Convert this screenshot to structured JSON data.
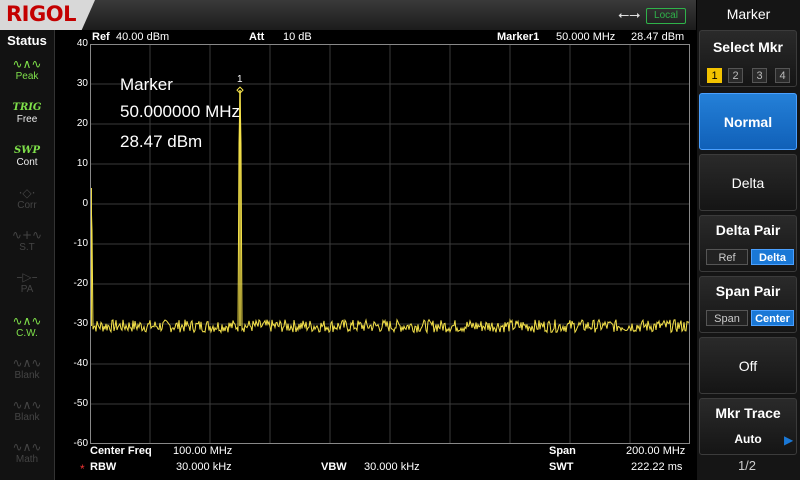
{
  "brand": "RIGOL",
  "remote_status": "Local",
  "status_panel": {
    "title": "Status",
    "items": [
      {
        "name": "peak",
        "label": "Peak",
        "active": true
      },
      {
        "name": "trig",
        "label": "TRIG",
        "value": "Free",
        "active": true
      },
      {
        "name": "swp",
        "label": "SWP",
        "value": "Cont",
        "active": true
      },
      {
        "name": "corr",
        "label": "Corr",
        "active": false
      },
      {
        "name": "st",
        "label": "S.T",
        "active": false
      },
      {
        "name": "pa",
        "label": "PA",
        "active": false
      },
      {
        "name": "cw",
        "label": "C.W.",
        "active": true
      },
      {
        "name": "blank1",
        "label": "Blank",
        "active": false
      },
      {
        "name": "blank2",
        "label": "Blank",
        "active": false
      },
      {
        "name": "math",
        "label": "Math",
        "active": false
      }
    ]
  },
  "header": {
    "ref_label": "Ref",
    "ref_value": "40.00 dBm",
    "att_label": "Att",
    "att_value": "10 dB",
    "marker_label": "Marker1",
    "marker_freq": "50.000 MHz",
    "marker_amp": "28.47 dBm"
  },
  "marker_readout": {
    "title": "Marker",
    "freq": "50.000000 MHz",
    "amp": "28.47 dBm",
    "tag": "1"
  },
  "footer": {
    "center_label": "Center Freq",
    "center_value": "100.00 MHz",
    "span_label": "Span",
    "span_value": "200.00 MHz",
    "rbw_label": "RBW",
    "rbw_value": "30.000 kHz",
    "vbw_label": "VBW",
    "vbw_value": "30.000 kHz",
    "swt_label": "SWT",
    "swt_value": "222.22 ms"
  },
  "softkeys": {
    "title": "Marker",
    "select_mkr": {
      "label": "Select Mkr",
      "options": [
        "1",
        "2",
        "3",
        "4"
      ],
      "selected": "1"
    },
    "normal": "Normal",
    "delta": "Delta",
    "delta_pair": {
      "label": "Delta Pair",
      "ref": "Ref",
      "delta": "Delta",
      "selected": "Delta"
    },
    "span_pair": {
      "label": "Span Pair",
      "span": "Span",
      "center": "Center",
      "selected": "Center"
    },
    "off": "Off",
    "mkr_trace": {
      "label": "Mkr Trace",
      "value": "Auto"
    },
    "page": "1/2"
  },
  "colors": {
    "trace": "#f5e24a",
    "grid": "#3a3a3a",
    "accent": "#1a78d6",
    "brand": "#c40000"
  },
  "chart_data": {
    "type": "line",
    "x_unit": "MHz",
    "y_unit": "dBm",
    "xlim": [
      0,
      200
    ],
    "ylim": [
      -60,
      40
    ],
    "yticks": [
      "40",
      "30",
      "20",
      "10",
      "0",
      "-10",
      "-20",
      "-30",
      "-40",
      "-50",
      "-60"
    ],
    "noise_floor": -30.5,
    "peaks": [
      {
        "x": 0.4,
        "y": 4
      },
      {
        "x": 50.0,
        "y": 28.47
      },
      {
        "x": 42.5,
        "y": -25
      }
    ],
    "grid": true
  }
}
